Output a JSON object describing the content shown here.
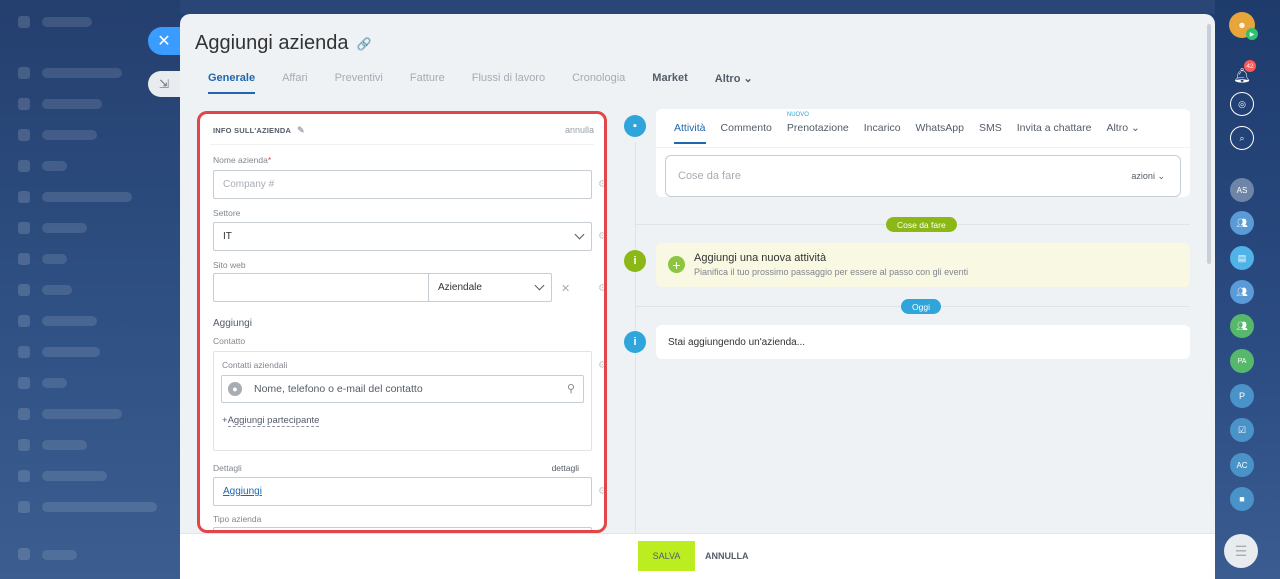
{
  "window": {
    "title": "Aggiungi azienda"
  },
  "tabs": [
    {
      "label": "Generale"
    },
    {
      "label": "Affari"
    },
    {
      "label": "Preventivi"
    },
    {
      "label": "Fatture"
    },
    {
      "label": "Flussi di lavoro"
    },
    {
      "label": "Cronologia"
    },
    {
      "label": "Market"
    },
    {
      "label": "Altro"
    }
  ],
  "form": {
    "section_title": "INFO SULL'AZIENDA",
    "cancel_label": "annulla",
    "company_name_label": "Nome azienda",
    "company_name_required": "*",
    "company_name_placeholder": "Company #",
    "sector_label": "Settore",
    "sector_value": "IT",
    "website_label": "Sito web",
    "website_value": "",
    "website_type": "Aziendale",
    "add_heading": "Aggiungi",
    "contact_label": "Contatto",
    "company_contacts_label": "Contatti aziendali",
    "contact_search_placeholder": "Nome, telefono o e-mail del contatto",
    "add_participant": "Aggiungi partecipante",
    "add_participant_prefix": "+",
    "details_label": "Dettagli",
    "details_link": "dettagli",
    "details_add": "Aggiungi",
    "company_type_label": "Tipo azienda"
  },
  "timeline": {
    "tabs": [
      {
        "label": "Attività"
      },
      {
        "label": "Commento"
      },
      {
        "label": "Prenotazione",
        "badge": "NUOVO"
      },
      {
        "label": "Incarico"
      },
      {
        "label": "WhatsApp"
      },
      {
        "label": "SMS"
      },
      {
        "label": "Invita a chattare"
      },
      {
        "label": "Altro"
      }
    ],
    "todo_placeholder": "Cose da fare",
    "actions_label": "azioni",
    "todo_pill": "Cose da fare",
    "new_activity_title": "Aggiungi una nuova attività",
    "new_activity_subtitle": "Pianifica il tuo prossimo passaggio per essere al passo con gli eventi",
    "today_pill": "Oggi",
    "adding_text": "Stai aggiungendo un'azienda..."
  },
  "footer": {
    "save_label": "SALVA",
    "cancel_label": "ANNULLA"
  },
  "right_bar": {
    "notification_count": "42",
    "items": [
      {
        "initials": "AS"
      },
      {
        "initials": "PA"
      },
      {
        "initials": "P"
      },
      {
        "initials": "AC"
      }
    ]
  },
  "colors": {
    "accent_blue": "#2067b0",
    "highlight_red": "#e24648",
    "save_green": "#bbed21",
    "todo_green": "#8cb816",
    "today_blue": "#2fa5db"
  }
}
